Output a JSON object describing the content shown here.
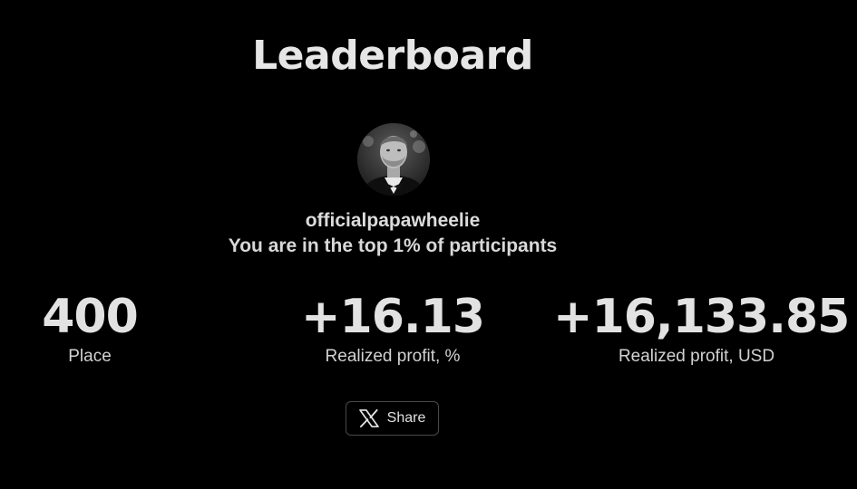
{
  "header": {
    "title": "Leaderboard"
  },
  "profile": {
    "username": "officialpapawheelie",
    "rank_note": "You are in the top 1% of participants"
  },
  "stats": [
    {
      "value": "400",
      "label": "Place"
    },
    {
      "value": "+16.13",
      "label": "Realized profit, %"
    },
    {
      "value": "+16,133.85",
      "label": "Realized profit, USD"
    }
  ],
  "share": {
    "label": "Share",
    "icon": "x-logo-icon"
  }
}
